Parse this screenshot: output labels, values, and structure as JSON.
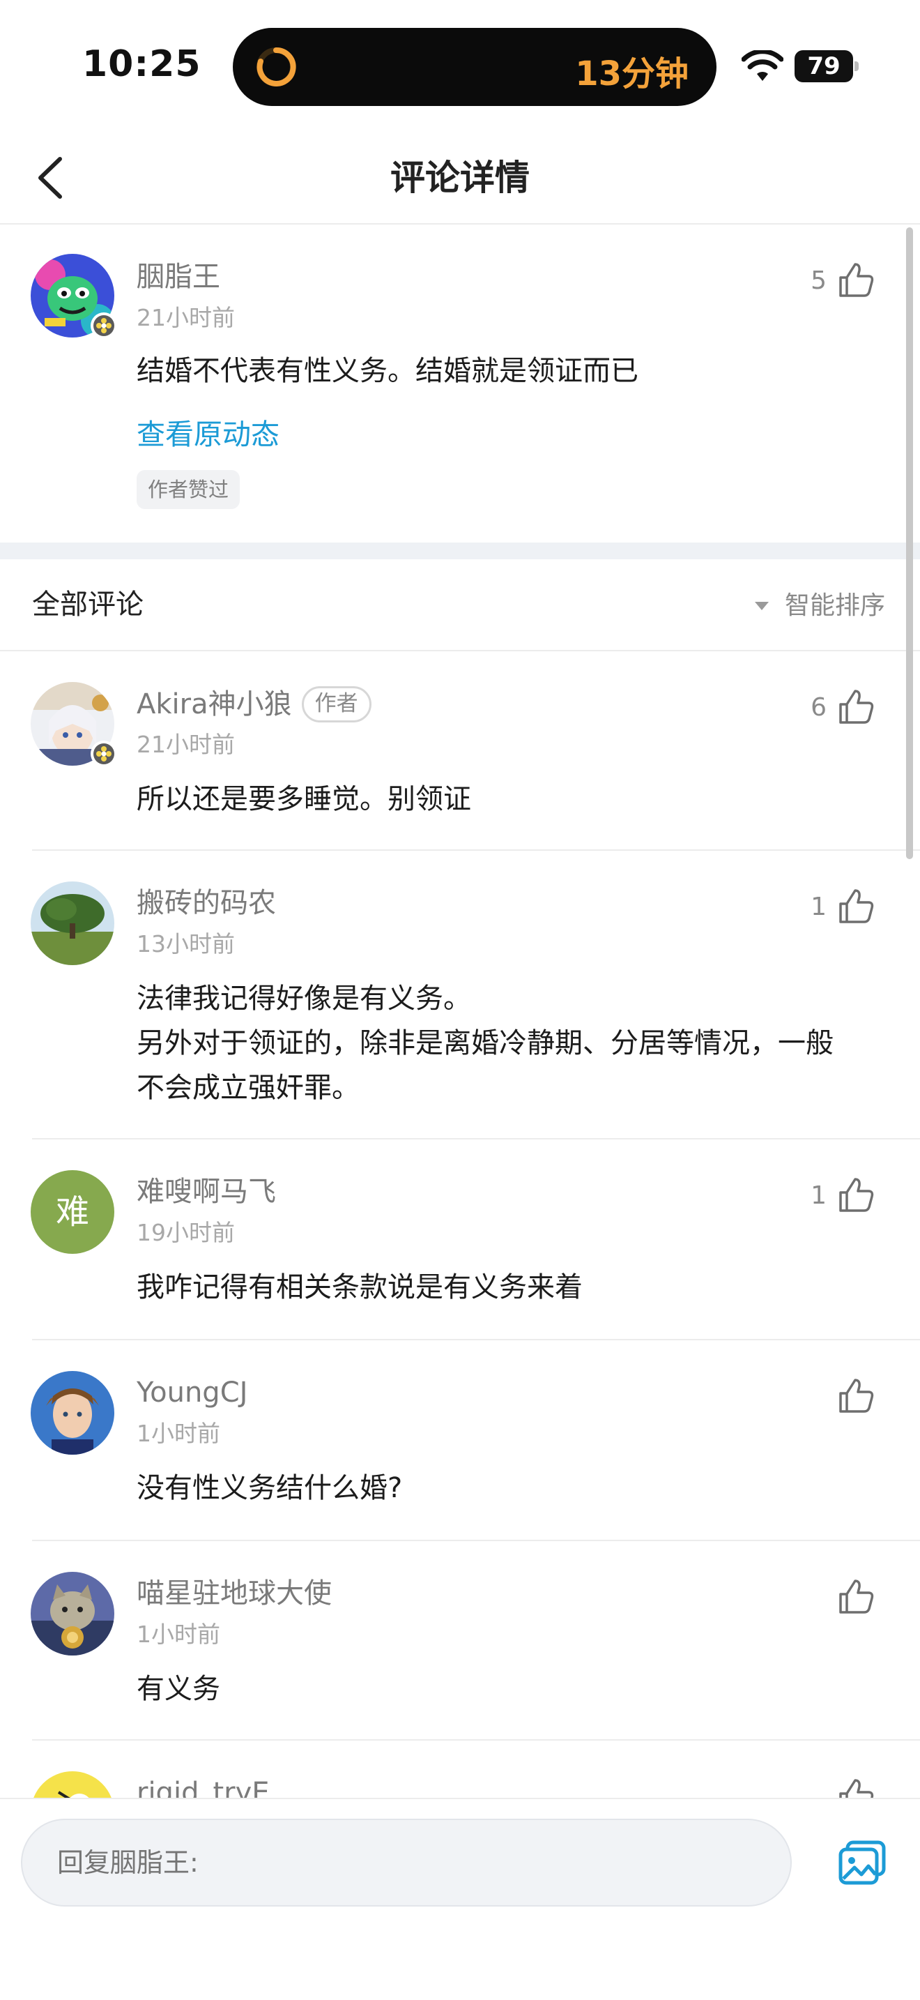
{
  "status_bar": {
    "time": "10:25",
    "timer_text": "13分钟",
    "battery": "79"
  },
  "nav": {
    "title": "评论详情"
  },
  "original_comment": {
    "username": "胭脂王",
    "time": "21小时前",
    "text": "结婚不代表有性义务。结婚就是领证而已",
    "likes": "5",
    "view_link": "查看原动态",
    "tag": "作者赞过"
  },
  "comments_header": {
    "title": "全部评论",
    "sort_label": "智能排序"
  },
  "comments": [
    {
      "username": "Akira神小狼",
      "badge": "作者",
      "time": "21小时前",
      "lines": [
        "所以还是要多睡觉。别领证"
      ],
      "likes": "6"
    },
    {
      "username": "搬砖的码农",
      "time": "13小时前",
      "lines": [
        "法律我记得好像是有义务。",
        "另外对于领证的，除非是离婚冷静期、分居等情况，一般",
        "不会成立强奸罪。"
      ],
      "likes": "1"
    },
    {
      "username": "难嗖啊马飞",
      "avatar_letter": "难",
      "time": "19小时前",
      "lines": [
        "我咋记得有相关条款说是有义务来着"
      ],
      "likes": "1"
    },
    {
      "username": "YoungCJ",
      "time": "1小时前",
      "lines": [
        "没有性义务结什么婚?"
      ],
      "likes": ""
    },
    {
      "username": "喵星驻地球大使",
      "time": "1小时前",
      "lines": [
        "有义务"
      ],
      "likes": ""
    },
    {
      "username": "rigid_tryE",
      "time": "",
      "lines": [],
      "likes": ""
    }
  ],
  "reply": {
    "placeholder": "回复胭脂王:"
  },
  "colors": {
    "link": "#1c9bd6",
    "timer": "#f4a23a",
    "letter_avatar": "#86a94e"
  }
}
